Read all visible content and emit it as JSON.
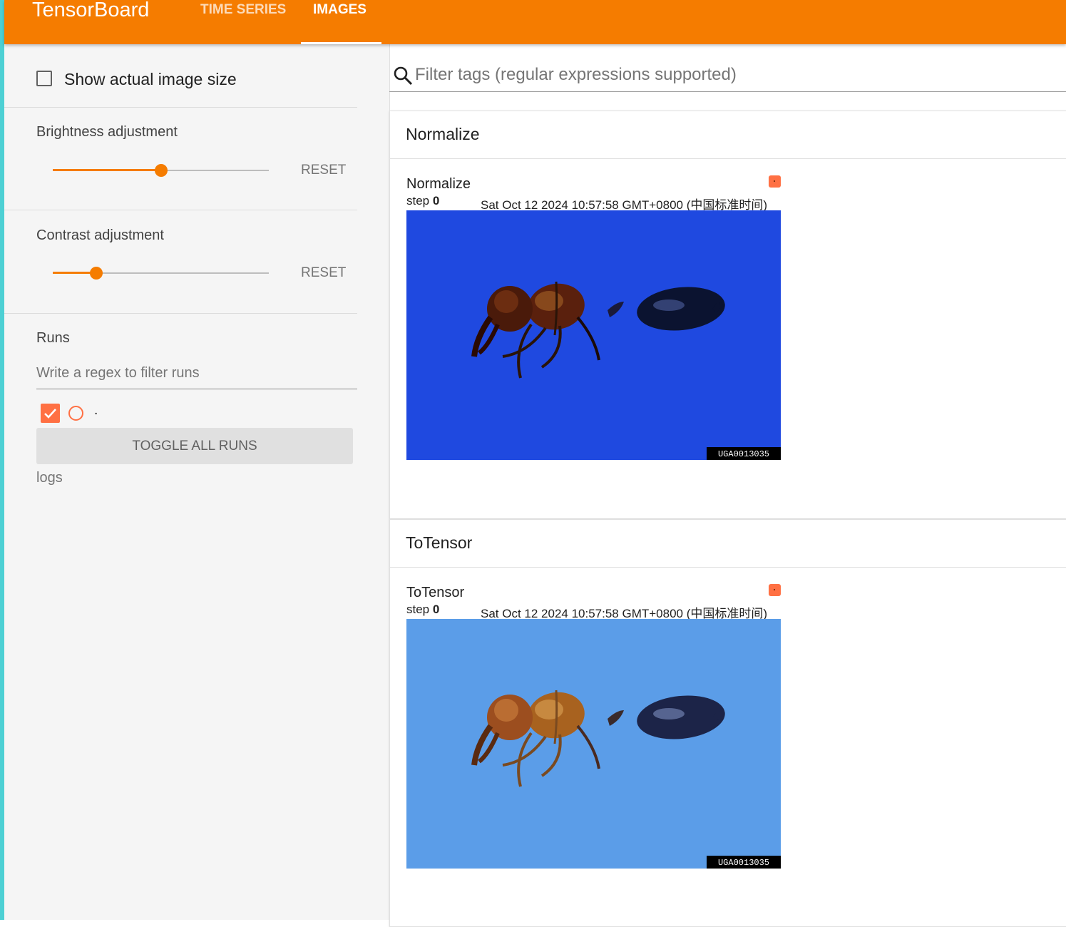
{
  "app": {
    "brand": "TensorBoard",
    "tabs": [
      "TIME SERIES",
      "IMAGES"
    ],
    "active_tab": "IMAGES",
    "accent_color": "#f57c00"
  },
  "sidebar": {
    "show_actual_size_label": "Show actual image size",
    "show_actual_size_checked": false,
    "brightness": {
      "title": "Brightness adjustment",
      "reset_label": "RESET",
      "value_fraction": 0.5
    },
    "contrast": {
      "title": "Contrast adjustment",
      "reset_label": "RESET",
      "value_fraction": 0.2
    },
    "runs": {
      "title": "Runs",
      "filter_placeholder": "Write a regex to filter runs",
      "items": [
        {
          "name": ".",
          "checked": true,
          "color": "#ff7043"
        }
      ],
      "toggle_all_label": "TOGGLE ALL RUNS",
      "logdir": "logs"
    }
  },
  "main": {
    "filter_placeholder": "Filter tags (regular expressions supported)",
    "cards": [
      {
        "group": "Normalize",
        "tag": "Normalize",
        "step_label": "step",
        "step": "0",
        "timestamp": "Sat Oct 12 2024 10:57:58 GMT+0800 (中国标准时间)",
        "image_label": "UGA0013035",
        "image_background": "#1f49e0"
      },
      {
        "group": "ToTensor",
        "tag": "ToTensor",
        "step_label": "step",
        "step": "0",
        "timestamp": "Sat Oct 12 2024 10:57:58 GMT+0800 (中国标准时间)",
        "image_label": "UGA0013035",
        "image_background": "#5b9de8"
      }
    ]
  }
}
